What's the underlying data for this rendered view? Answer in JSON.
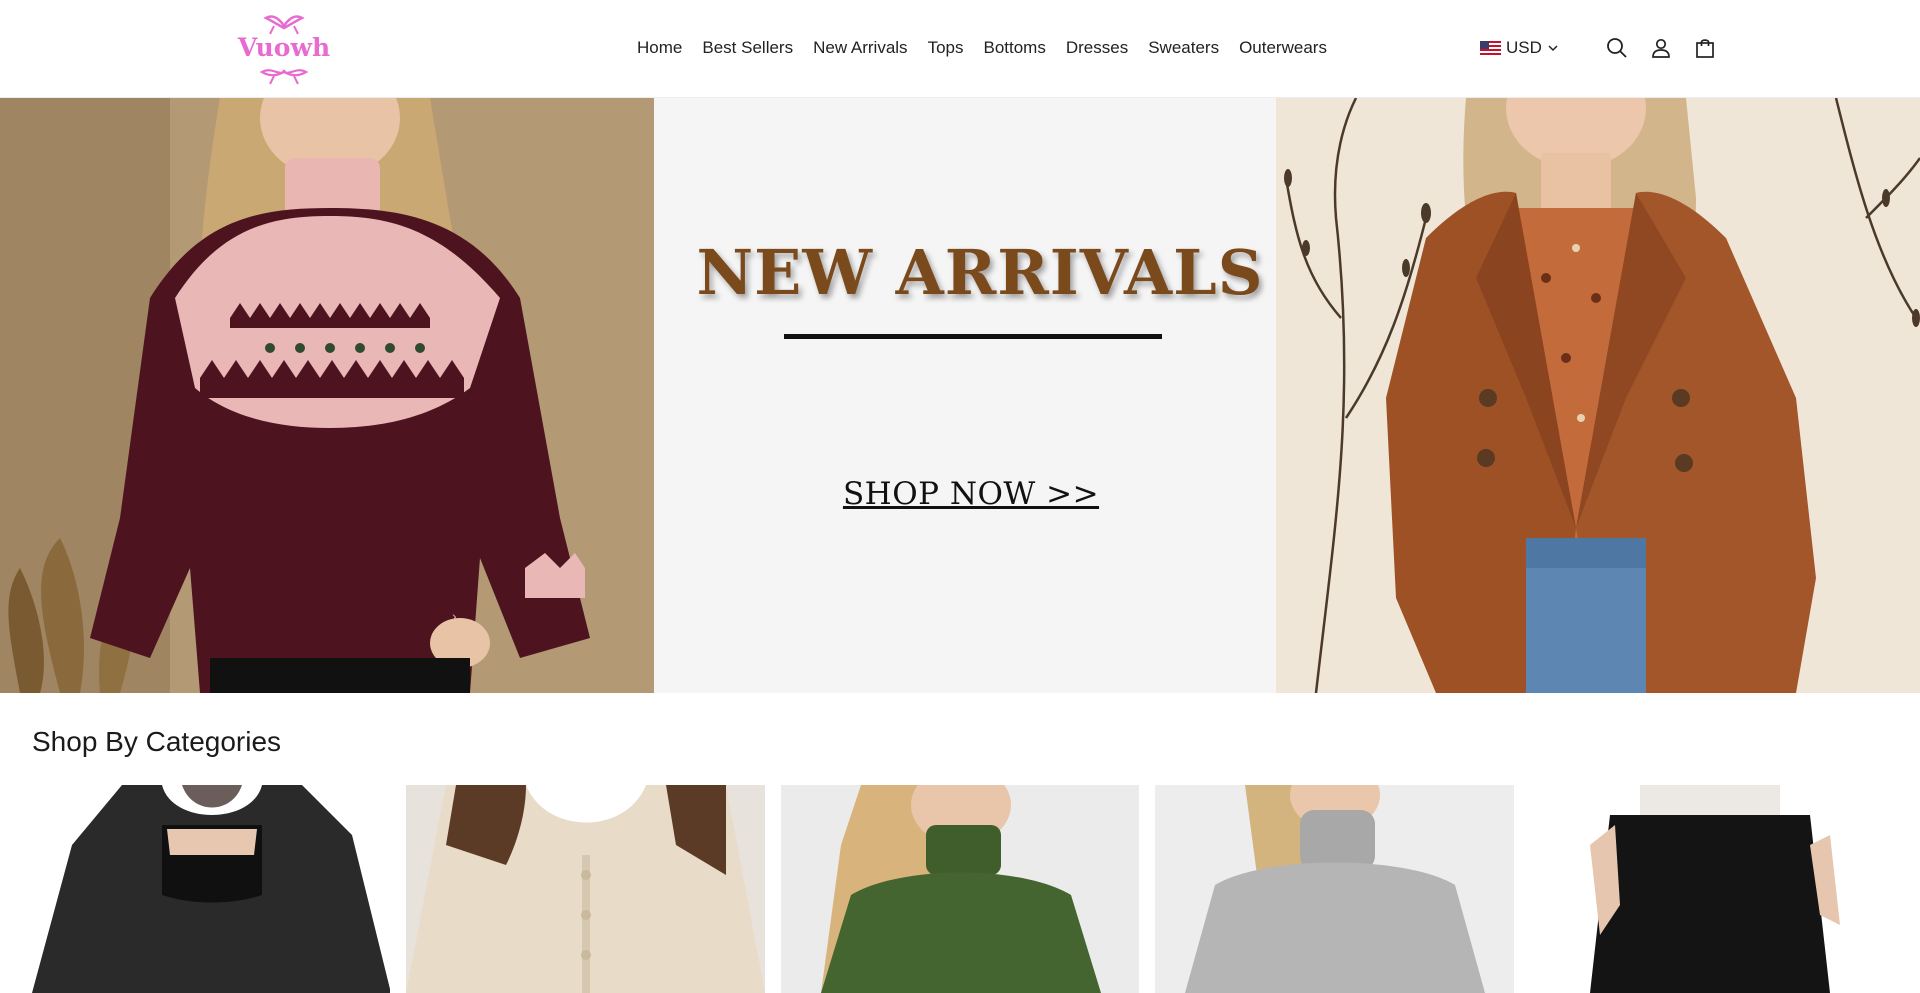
{
  "brand": {
    "logo_text": "Vuowh",
    "logo_color": "#e86bd0"
  },
  "nav": {
    "items": [
      "Home",
      "Best Sellers",
      "New Arrivals",
      "Tops",
      "Bottoms",
      "Dresses",
      "Sweaters",
      "Outerwears"
    ]
  },
  "header": {
    "currency": "USD",
    "icons": [
      "flag-us-icon",
      "chevron-down-icon",
      "search-icon",
      "account-icon",
      "cart-icon"
    ]
  },
  "hero": {
    "title": "NEW ARRIVALS",
    "cta": "SHOP NOW >>",
    "title_color": "#7a4a1c",
    "slider_arrow": "›"
  },
  "categories": {
    "title": "Shop By Categories",
    "items": [
      {
        "name": "black-top"
      },
      {
        "name": "cream-cardigan"
      },
      {
        "name": "green-turtleneck"
      },
      {
        "name": "grey-sweater"
      },
      {
        "name": "black-pants"
      }
    ]
  }
}
